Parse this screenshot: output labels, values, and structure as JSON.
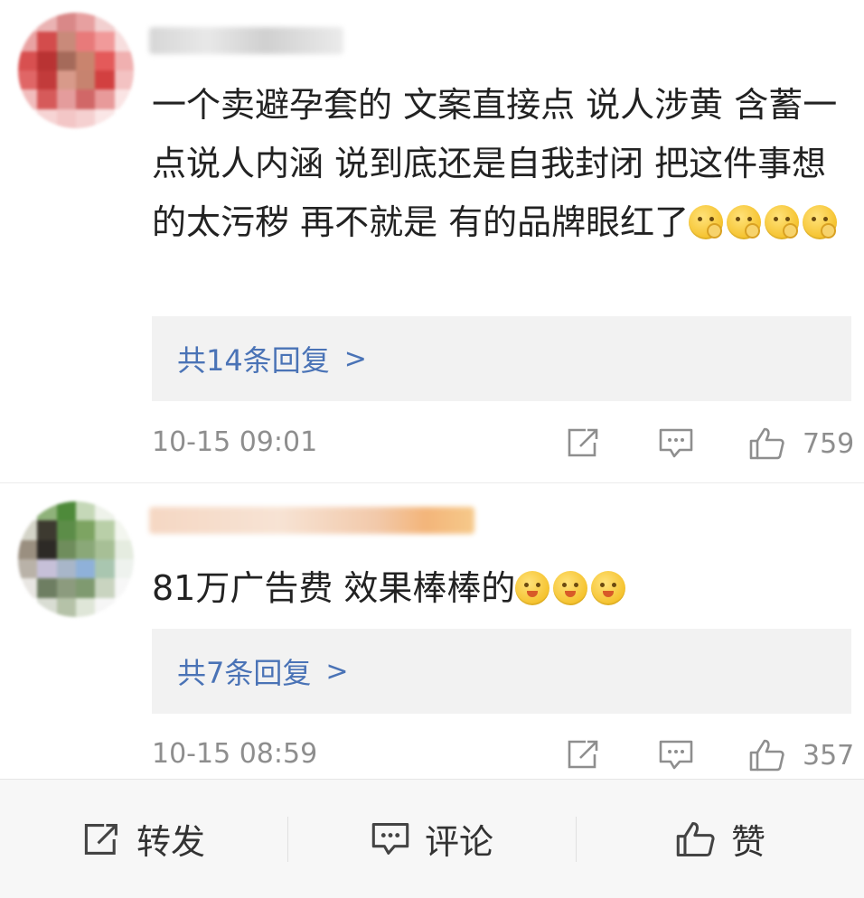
{
  "comments": [
    {
      "text": "一个卖避孕套的 文案直接点 说人涉黄 含蓄一点说人内涵 说到底还是自我封闭 把这件事想的太污秽 再不就是 有的品牌眼红了",
      "emojis": [
        "shush",
        "shush",
        "shush",
        "shush"
      ],
      "replies_label": "共14条回复",
      "reply_chevron": ">",
      "time": "10-15 09:01",
      "likes": "759"
    },
    {
      "text": "81万广告费 效果棒棒的",
      "emojis": [
        "blush",
        "blush",
        "blush"
      ],
      "replies_label": "共7条回复",
      "reply_chevron": ">",
      "time": "10-15 08:59",
      "likes": "357"
    }
  ],
  "icons": {
    "share": "share-icon",
    "comment": "comment-icon",
    "like": "thumbs-up-icon"
  },
  "bottom_bar": {
    "share_label": "转发",
    "comment_label": "评论",
    "like_label": "赞"
  },
  "colors": {
    "link_blue": "#4a73b6",
    "meta_gray": "#8e8e8e",
    "reply_bg": "#f2f2f2"
  }
}
